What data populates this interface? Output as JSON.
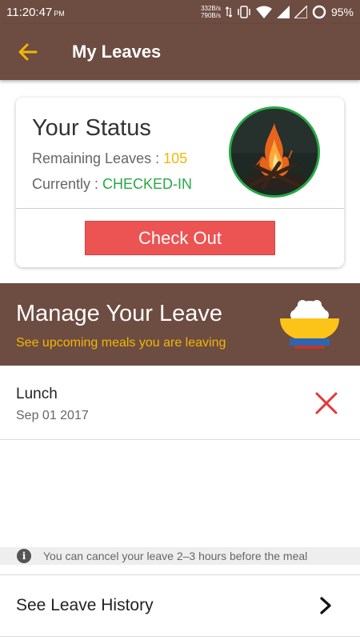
{
  "statusbar": {
    "time": "11:20:47",
    "ampm": "PM",
    "net_up": "332B/s",
    "net_down": "790B/s",
    "battery": "95%"
  },
  "appbar": {
    "title": "My Leaves",
    "back_icon": "arrow-left-icon"
  },
  "status_card": {
    "title": "Your Status",
    "remaining_label": "Remaining Leaves : ",
    "remaining_value": "105",
    "currently_label": "Currently : ",
    "currently_value": "CHECKED-IN",
    "checkout_label": "Check Out"
  },
  "manage": {
    "title": "Manage Your Leave",
    "subtitle": "See upcoming meals you are leaving"
  },
  "leaves": [
    {
      "meal": "Lunch",
      "date": "Sep 01 2017"
    }
  ],
  "info": {
    "text": "You can cancel your leave 2–3 hours before the meal"
  },
  "history": {
    "label": "See Leave History"
  },
  "colors": {
    "brand": "#6d4c41",
    "accent": "#f2b705",
    "success": "#27a844",
    "danger": "#ec5454"
  }
}
